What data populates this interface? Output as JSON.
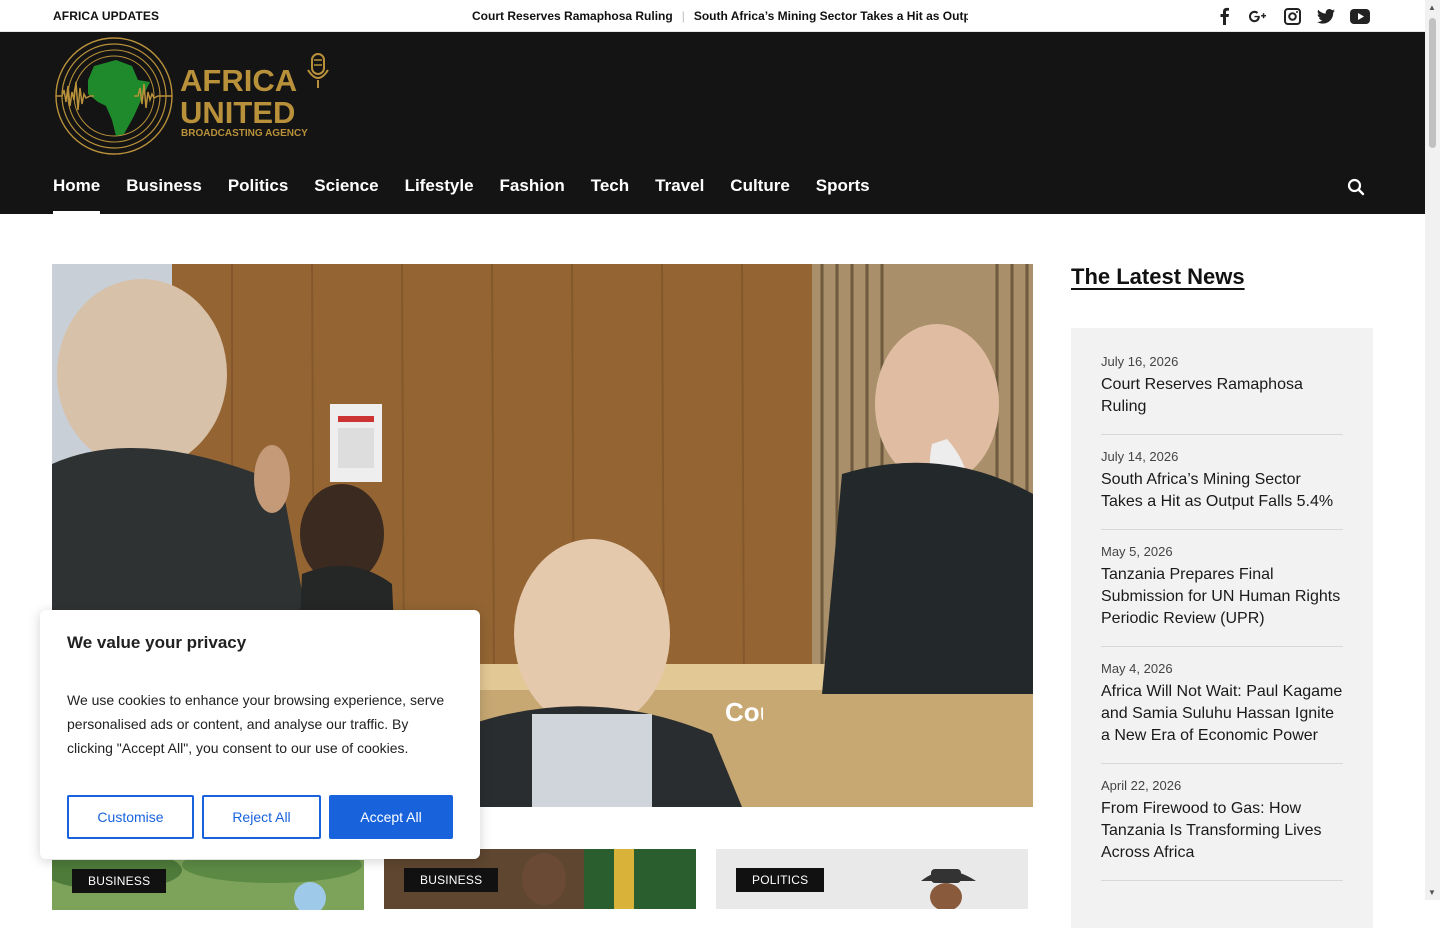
{
  "topbar": {
    "brand_tag": "AFRICA UPDATES",
    "ticker": [
      "Court Reserves Ramaphosa Ruling",
      "South Africa’s Mining Sector Takes a Hit as Output Fa"
    ],
    "social_icons": [
      "facebook-icon",
      "google-plus-icon",
      "instagram-icon",
      "twitter-icon",
      "youtube-icon"
    ]
  },
  "logo": {
    "line1": "AFRICA",
    "line2": "UNITED",
    "line3": "BROADCASTING AGENCY",
    "gold": "#b8913a",
    "green": "#1f8a2c"
  },
  "nav": {
    "items": [
      "Home",
      "Business",
      "Politics",
      "Science",
      "Lifestyle",
      "Fashion",
      "Tech",
      "Travel",
      "Culture",
      "Sports"
    ],
    "active": "Home"
  },
  "hero": {
    "caption": "Cou"
  },
  "cards": [
    {
      "category": "BUSINESS"
    },
    {
      "category": "BUSINESS"
    },
    {
      "category": "POLITICS"
    }
  ],
  "sidebar": {
    "title": "The Latest News",
    "items": [
      {
        "date": "July 16, 2026",
        "title": "Court Reserves Ramaphosa Ruling"
      },
      {
        "date": "July 14, 2026",
        "title": "South Africa’s Mining Sector Takes a Hit as Output Falls 5.4%"
      },
      {
        "date": "May 5, 2026",
        "title": "Tanzania Prepares Final Submission for UN Human Rights Periodic Review (UPR)"
      },
      {
        "date": "May 4, 2026",
        "title": "Africa Will Not Wait: Paul Kagame and Samia Suluhu Hassan Ignite a New Era of Economic Power"
      },
      {
        "date": "April 22, 2026",
        "title": "From Firewood to Gas: How Tanzania Is Transforming Lives Across Africa"
      }
    ]
  },
  "cookie": {
    "title": "We value your privacy",
    "body": "We use cookies to enhance your browsing experience, serve personalised ads or content, and analyse our traffic. By clicking \"Accept All\", you consent to our use of cookies.",
    "customise": "Customise",
    "reject": "Reject All",
    "accept": "Accept All",
    "accent": "#1863dc"
  }
}
